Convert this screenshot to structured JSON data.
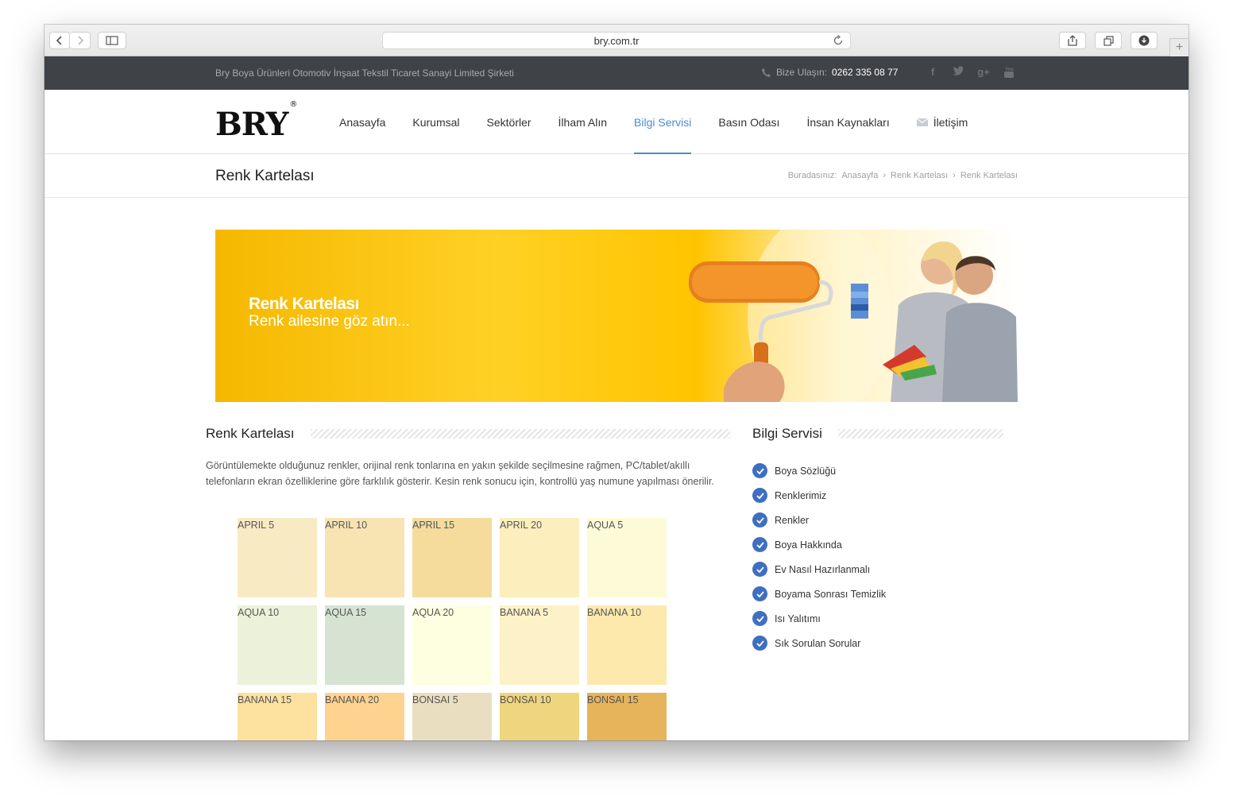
{
  "browser": {
    "url": "bry.com.tr"
  },
  "topbar": {
    "company": "Bry Boya Ürünleri Otomotiv İnşaat Tekstil Ticaret Sanayi Limited Şirketi",
    "contact_label": "Bize Ulaşın:",
    "contact_number": "0262 335 08 77",
    "socials": [
      "facebook-icon",
      "twitter-icon",
      "google-plus-icon",
      "youtube-icon"
    ]
  },
  "header": {
    "logo": "BRY",
    "logo_mark": "®",
    "nav": [
      {
        "label": "Anasayfa"
      },
      {
        "label": "Kurumsal"
      },
      {
        "label": "Sektörler"
      },
      {
        "label": "İlham Alın"
      },
      {
        "label": "Bilgi Servisi"
      },
      {
        "label": "Basın Odası"
      },
      {
        "label": "İnsan Kaynakları"
      },
      {
        "label": "İletişim"
      }
    ],
    "active_color": "#4a8ad4"
  },
  "titlebar": {
    "title": "Renk Kartelası",
    "breadcrumb_prefix": "Buradasınız:",
    "breadcrumb": [
      "Anasayfa",
      "Renk Kartelası",
      "Renk Kartelası"
    ],
    "separator": "›"
  },
  "banner": {
    "title": "Renk Kartelası",
    "subtitle": "Renk ailesine göz atın..."
  },
  "main": {
    "title": "Renk Kartelası",
    "intro": "Görüntülemekte olduğunuz renkler, orijinal renk tonlarına en yakın şekilde seçilmesine rağmen, PC/tablet/akıllı telefonların ekran özelliklerine göre farklılık gösterir. Kesin renk sonucu için, kontrollü yaş numune yapılması önerilir.",
    "swatches": [
      {
        "name": "APRIL 5",
        "color": "#f8ebc4"
      },
      {
        "name": "APRIL 10",
        "color": "#f8e4b3"
      },
      {
        "name": "APRIL 15",
        "color": "#f5dc9d"
      },
      {
        "name": "APRIL 20",
        "color": "#fcefbd"
      },
      {
        "name": "AQUA 5",
        "color": "#fdfbd7"
      },
      {
        "name": "AQUA 10",
        "color": "#ebf2d9"
      },
      {
        "name": "AQUA 15",
        "color": "#d6e3d3"
      },
      {
        "name": "AQUA 20",
        "color": "#fefee1"
      },
      {
        "name": "BANANA 5",
        "color": "#fdf2c7"
      },
      {
        "name": "BANANA 10",
        "color": "#fde9ac"
      },
      {
        "name": "BANANA 15",
        "color": "#fde19f"
      },
      {
        "name": "BANANA 20",
        "color": "#fed38f"
      },
      {
        "name": "BONSAI 5",
        "color": "#e9dfc0"
      },
      {
        "name": "BONSAI 10",
        "color": "#f0d57f"
      },
      {
        "name": "BONSAI 15",
        "color": "#e6b45b"
      }
    ]
  },
  "sidebar": {
    "title": "Bilgi Servisi",
    "items": [
      {
        "label": "Boya Sözlüğü"
      },
      {
        "label": "Renklerimiz"
      },
      {
        "label": "Renkler"
      },
      {
        "label": "Boya Hakkında"
      },
      {
        "label": "Ev Nasıl Hazırlanmalı"
      },
      {
        "label": "Boyama Sonrası Temizlik"
      },
      {
        "label": "Isı Yalıtımı"
      },
      {
        "label": "Sık Sorulan Sorular"
      }
    ],
    "check_color": "#3e6fc0"
  }
}
